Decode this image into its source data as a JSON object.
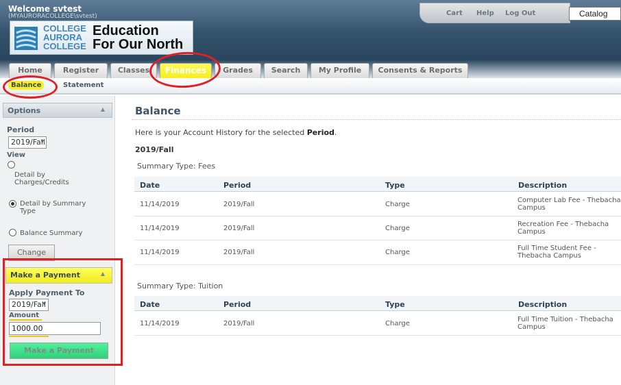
{
  "header": {
    "welcome": "Welcome svtest",
    "welcome_sub": "(MYAURORACOLLEGE\\svtest)",
    "logo_college_line1": "COLLEGE",
    "logo_college_line2": "AURORA",
    "logo_college_line3": "COLLEGE",
    "logo_tagline_line1": "Education",
    "logo_tagline_line2": "For Our North",
    "top_links": [
      "Cart",
      "Help",
      "Log Out"
    ],
    "search_value": "Catalog"
  },
  "tabs": [
    "Home",
    "Register",
    "Classes",
    "Finances",
    "Grades",
    "Search",
    "My Profile",
    "Consents & Reports"
  ],
  "active_tab": "Finances",
  "subnav": [
    "Balance",
    "Statement"
  ],
  "sidebar": {
    "options_title": "Options",
    "period_label": "Period",
    "period_value": "2019/Fall",
    "view_label": "View",
    "view_options": [
      "Detail by Charges/Credits",
      "Detail by Summary Type",
      "Balance Summary"
    ],
    "view_selected": "Detail by Summary Type",
    "change_button": "Change",
    "payment_title": "Make a Payment",
    "apply_label": "Apply Payment To",
    "apply_value": "2019/Fall",
    "amount_label": "Amount",
    "amount_value": "1000.00",
    "pay_button": "Make a Payment"
  },
  "main": {
    "title": "Balance",
    "intro_prefix": "Here is your Account History for the selected ",
    "intro_bold": "Period",
    "intro_suffix": ".",
    "period_heading": "2019/Fall",
    "columns": [
      "Date",
      "Period",
      "Type",
      "Description"
    ],
    "sections": [
      {
        "summary_type": "Summary Type:  Fees",
        "rows": [
          {
            "date": "11/14/2019",
            "period": "2019/Fall",
            "type": "Charge",
            "description": "Computer Lab Fee - Thebacha Campus"
          },
          {
            "date": "11/14/2019",
            "period": "2019/Fall",
            "type": "Charge",
            "description": "Recreation Fee - Thebacha Campus"
          },
          {
            "date": "11/14/2019",
            "period": "2019/Fall",
            "type": "Charge",
            "description": "Full Time Student Fee - Thebacha Campus"
          }
        ]
      },
      {
        "summary_type": "Summary Type:  Tuition",
        "rows": [
          {
            "date": "11/14/2019",
            "period": "2019/Fall",
            "type": "Charge",
            "description": "Full Time Tuition - Thebacha Campus"
          }
        ]
      }
    ]
  },
  "annotation_color": "#e01f27",
  "highlight_color": "#f4f021"
}
